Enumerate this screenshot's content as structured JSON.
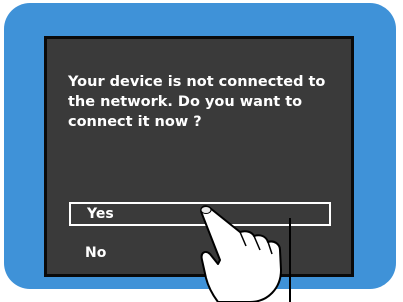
{
  "dialog": {
    "message": "Your device is not connected to the network.  Do you want to connect it now ?",
    "options": [
      {
        "label": "Yes",
        "selected": true
      },
      {
        "label": "No",
        "selected": false
      }
    ]
  },
  "icons": {
    "pointer": "pointing-hand-icon"
  },
  "colors": {
    "frame": "#3f92d8",
    "screen": "#3a3a3a",
    "border": "#0a0a0a",
    "text": "#ffffff"
  }
}
